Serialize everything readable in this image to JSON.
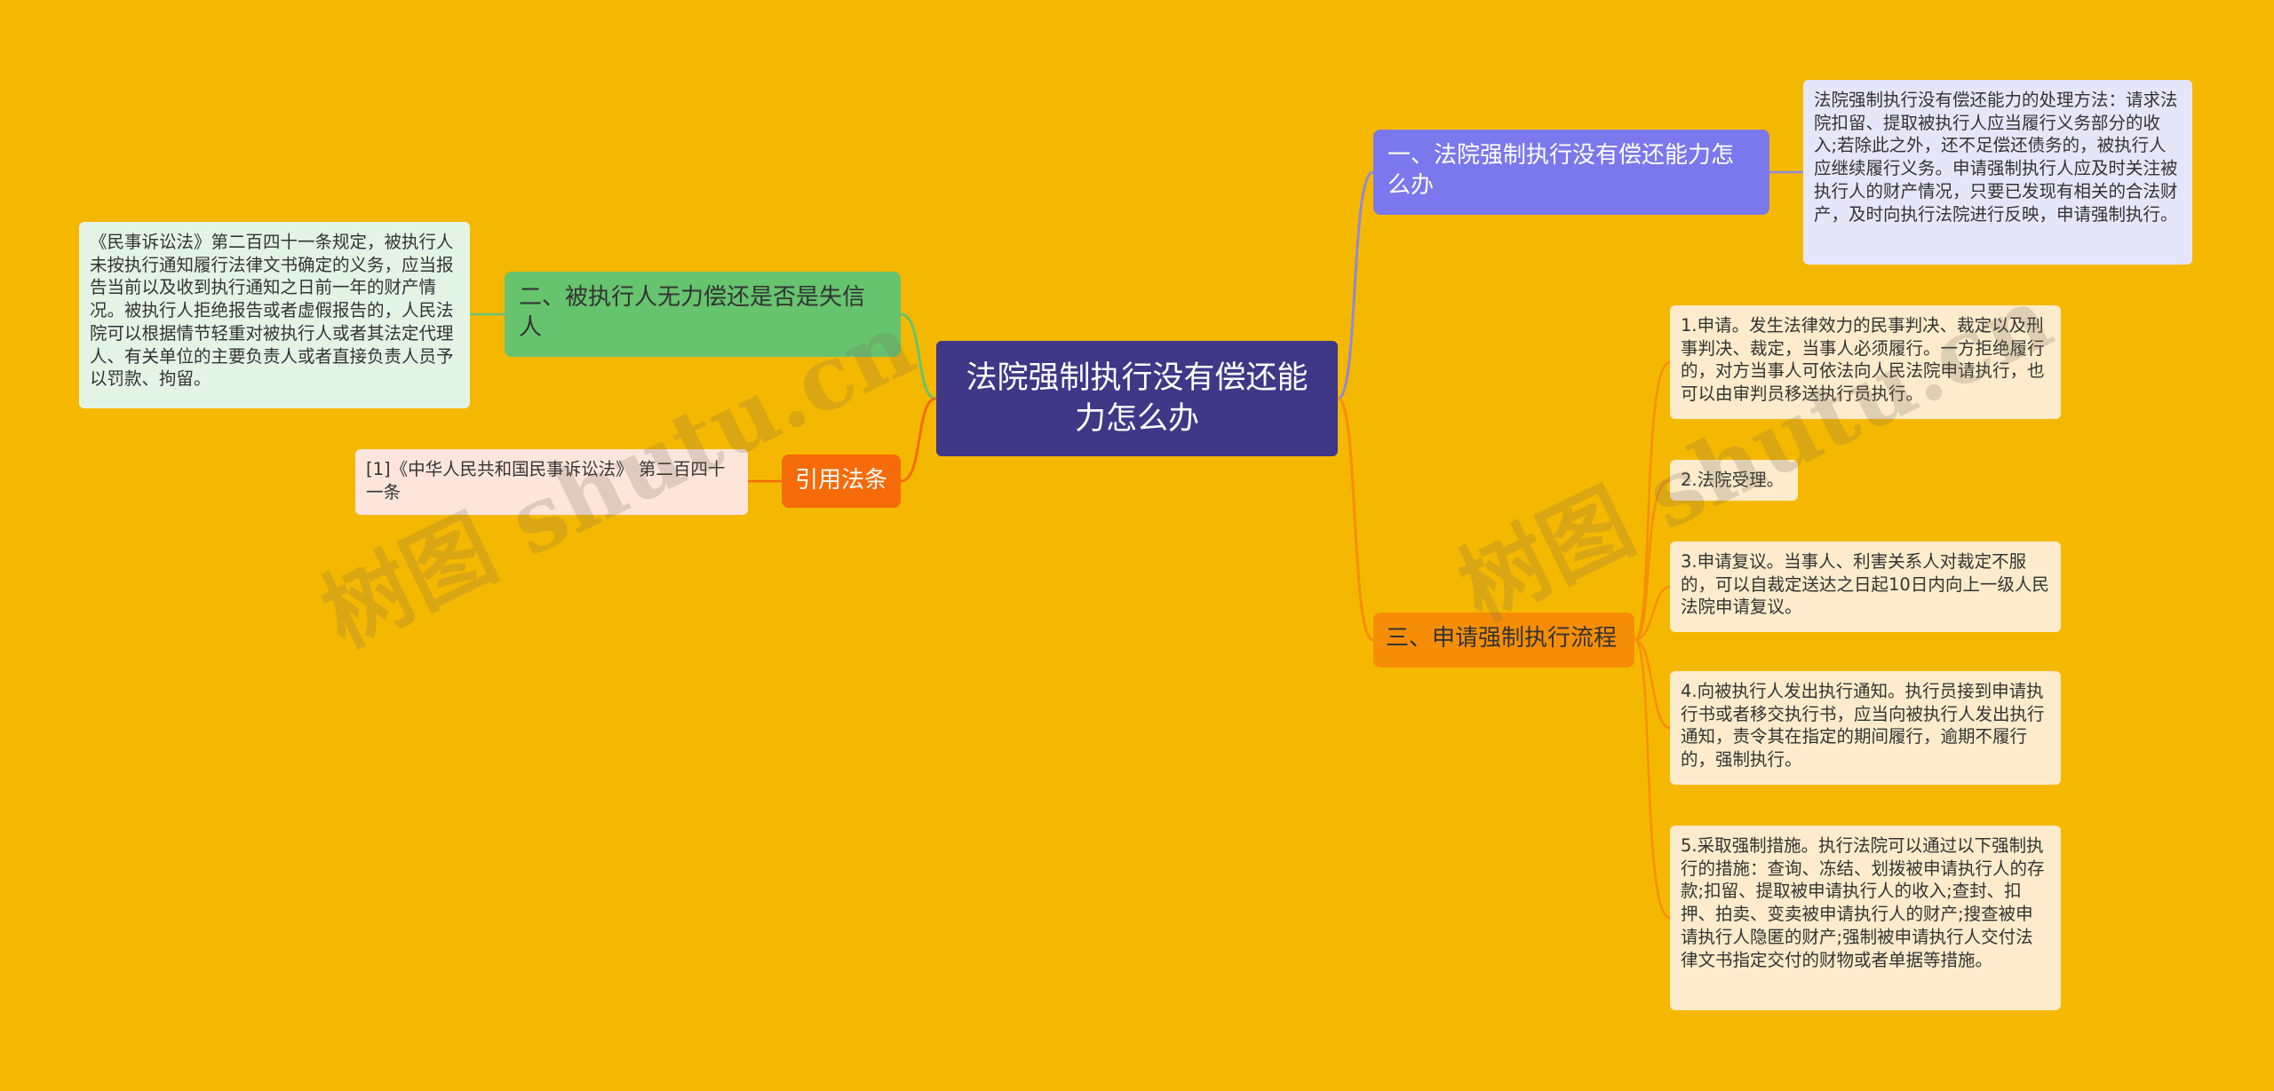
{
  "mindmap": {
    "root": "法院强制执行没有偿还能力怎么办",
    "branches": [
      {
        "label": "一、法院强制执行没有偿还能力怎么办",
        "children": [
          "法院强制执行没有偿还能力的处理方法：请求法院扣留、提取被执行人应当履行义务部分的收入;若除此之外，还不足偿还债务的，被执行人应继续履行义务。申请强制执行人应及时关注被执行人的财产情况，只要已发现有相关的合法财产，及时向执行法院进行反映，申请强制执行。"
        ]
      },
      {
        "label": "二、被执行人无力偿还是否是失信人",
        "children": [
          "《民事诉讼法》第二百四十一条规定，被执行人未按执行通知履行法律文书确定的义务，应当报告当前以及收到执行通知之日前一年的财产情况。被执行人拒绝报告或者虚假报告的，人民法院可以根据情节轻重对被执行人或者其法定代理人、有关单位的主要负责人或者直接负责人员予以罚款、拘留。"
        ]
      },
      {
        "label": "引用法条",
        "children": [
          "[1]《中华人民共和国民事诉讼法》 第二百四十一条"
        ]
      },
      {
        "label": "三、申请强制执行流程",
        "children": [
          "1.申请。发生法律效力的民事判决、裁定以及刑事判决、裁定，当事人必须履行。一方拒绝履行的，对方当事人可依法向人民法院申请执行，也可以由审判员移送执行员执行。",
          "2.法院受理。",
          "3.申请复议。当事人、利害关系人对裁定不服的，可以自裁定送达之日起10日内向上一级人民法院申请复议。",
          "4.向被执行人发出执行通知。执行员接到申请执行书或者移交执行书，应当向被执行人发出执行通知，责令其在指定的期间履行，逾期不履行的，强制执行。",
          "5.采取强制措施。执行法院可以通过以下强制执行的措施：查询、冻结、划拨被申请执行人的存款;扣留、提取被申请执行人的收入;查封、扣押、拍卖、变卖被申请执行人的财产;搜查被申请执行人隐匿的财产;强制被申请执行人交付法律文书指定交付的财物或者单据等措施。"
        ]
      }
    ]
  },
  "watermark": "树图 shutu.cn",
  "colors": {
    "background": "#F5B800",
    "root": "#3E3887",
    "branch1": "#7A78EC",
    "branch2": "#66C36E",
    "branch3": "#F56B0A",
    "branch4": "#F58E06"
  }
}
